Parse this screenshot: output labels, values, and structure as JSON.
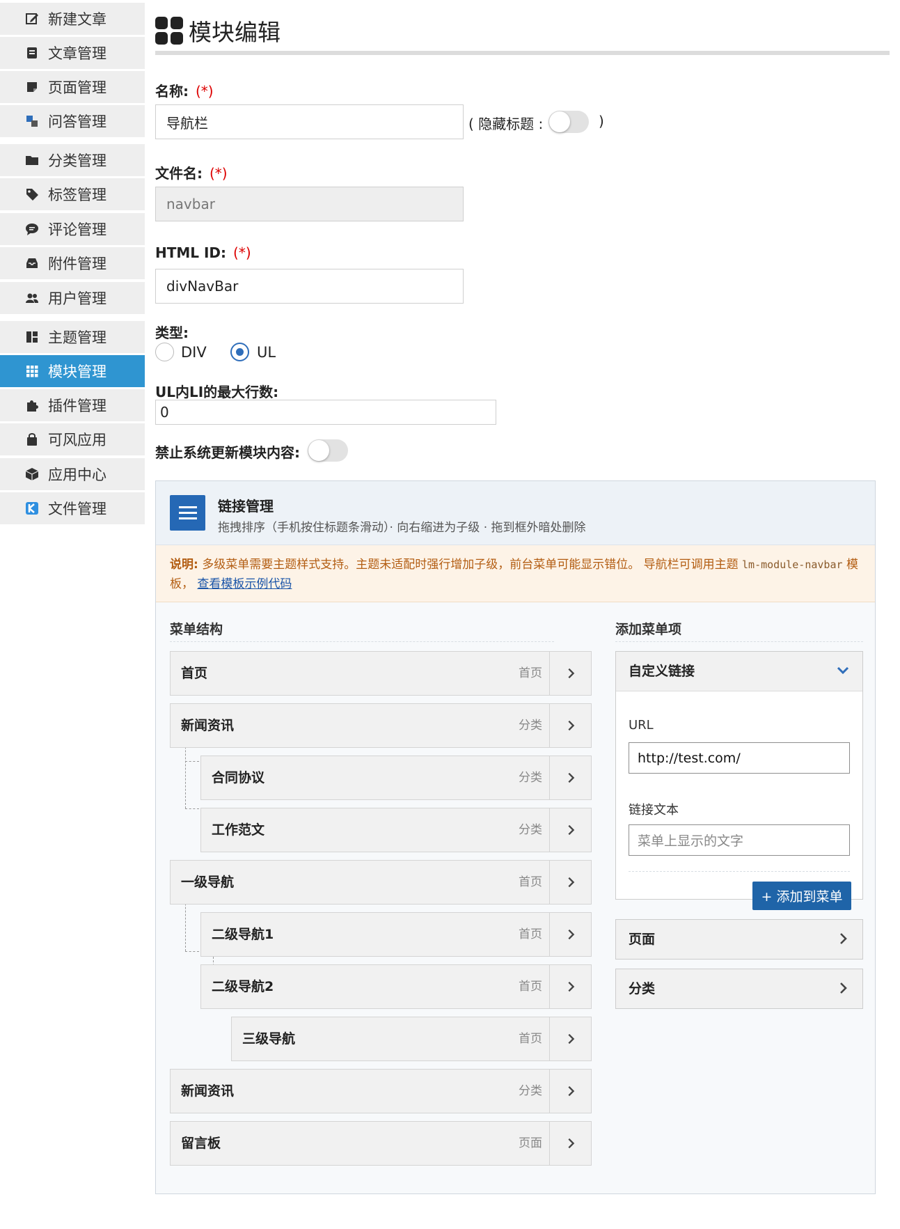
{
  "sidebar": {
    "items": [
      {
        "label": "新建文章",
        "icon": "edit-icon"
      },
      {
        "label": "文章管理",
        "icon": "article-icon"
      },
      {
        "label": "页面管理",
        "icon": "page-icon"
      },
      {
        "label": "问答管理",
        "icon": "translate-icon"
      },
      {
        "label": "分类管理",
        "icon": "folder-icon"
      },
      {
        "label": "标签管理",
        "icon": "tag-icon"
      },
      {
        "label": "评论管理",
        "icon": "comment-icon"
      },
      {
        "label": "附件管理",
        "icon": "inbox-icon"
      },
      {
        "label": "用户管理",
        "icon": "users-icon"
      },
      {
        "label": "主题管理",
        "icon": "layout-icon"
      },
      {
        "label": "模块管理",
        "icon": "grid-icon",
        "active": true
      },
      {
        "label": "插件管理",
        "icon": "puzzle-icon"
      },
      {
        "label": "可风应用",
        "icon": "bag-icon"
      },
      {
        "label": "应用中心",
        "icon": "cube-icon"
      },
      {
        "label": "文件管理",
        "icon": "k-logo-icon"
      }
    ]
  },
  "page": {
    "title": "模块编辑"
  },
  "form": {
    "name_label": "名称:",
    "required_mark": "(*)",
    "name_value": "导航栏",
    "hide_title_open": "( 隐藏标题 :",
    "hide_title_close": ")",
    "filename_label": "文件名:",
    "filename_value": "navbar",
    "htmlid_label": "HTML ID:",
    "htmlid_value": "divNavBar",
    "type_label": "类型:",
    "type_options": [
      "DIV",
      "UL"
    ],
    "type_selected": "UL",
    "maxli_label": "UL内LI的最大行数:",
    "maxli_value": "0",
    "no_update_label": "禁止系统更新模块内容:",
    "hide_title_on": false,
    "no_update_on": false
  },
  "link_panel": {
    "title": "链接管理",
    "subtitle": "拖拽排序（手机按住标题条滑动）· 向右缩进为子级 · 拖到框外暗处删除",
    "notice_label": "说明:",
    "notice_text": "多级菜单需要主题样式支持。主题未适配时强行增加子级，前台菜单可能显示错位。 导航栏可调用主题",
    "notice_code": "lm-module-navbar",
    "notice_suffix": "模板，",
    "notice_link": "查看模板示例代码"
  },
  "menu": {
    "structure_title": "菜单结构",
    "items": [
      {
        "title": "首页",
        "type": "首页",
        "level": 0
      },
      {
        "title": "新闻资讯",
        "type": "分类",
        "level": 0
      },
      {
        "title": "合同协议",
        "type": "分类",
        "level": 1
      },
      {
        "title": "工作范文",
        "type": "分类",
        "level": 1
      },
      {
        "title": "一级导航",
        "type": "首页",
        "level": 0
      },
      {
        "title": "二级导航1",
        "type": "首页",
        "level": 1
      },
      {
        "title": "二级导航2",
        "type": "首页",
        "level": 1
      },
      {
        "title": "三级导航",
        "type": "首页",
        "level": 2
      },
      {
        "title": "新闻资讯",
        "type": "分类",
        "level": 0
      },
      {
        "title": "留言板",
        "type": "页面",
        "level": 0
      }
    ]
  },
  "add_menu": {
    "title": "添加菜单项",
    "custom_link_title": "自定义链接",
    "url_label": "URL",
    "url_value": "http://test.com/",
    "text_label": "链接文本",
    "text_placeholder": "菜单上显示的文字",
    "add_button": "+ 添加到菜单",
    "page_section": "页面",
    "category_section": "分类"
  },
  "colors": {
    "active": "#2f95d1",
    "primary": "#1f64a8",
    "required": "#dd0000",
    "notice_text": "#b35d12"
  }
}
